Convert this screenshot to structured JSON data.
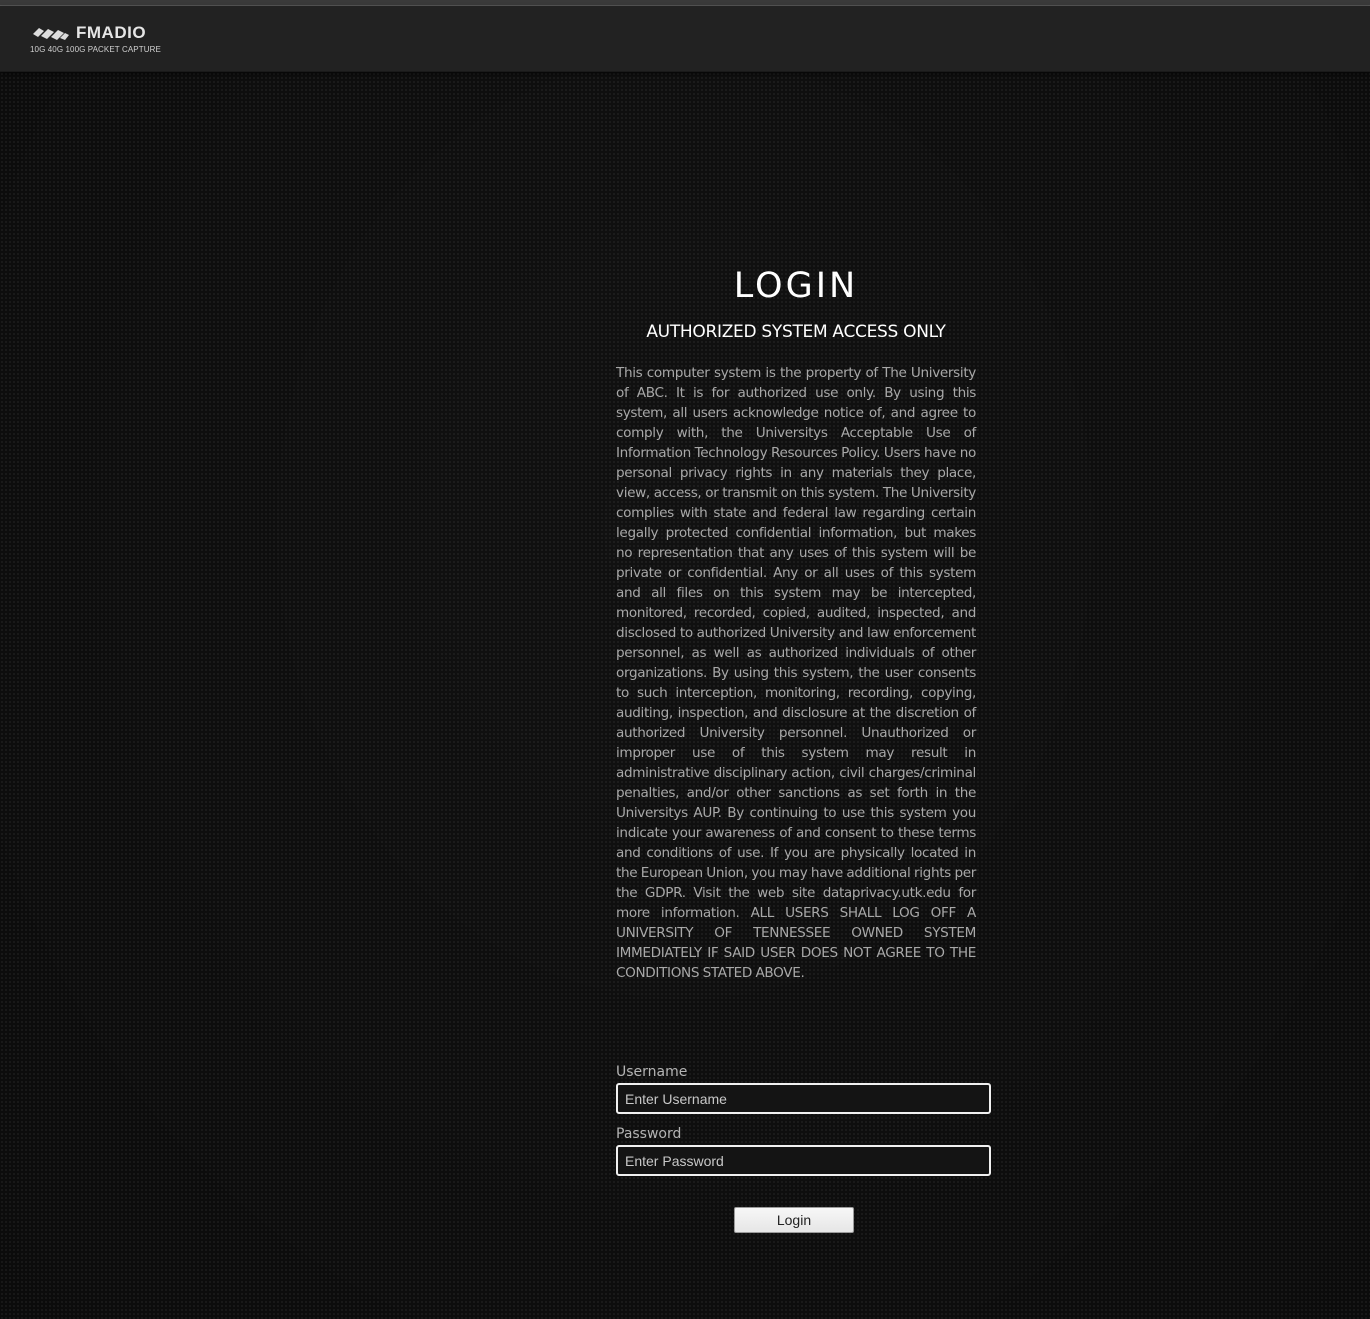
{
  "header": {
    "brand_name": "FMADIO",
    "brand_tagline": "10G 40G 100G  PACKET CAPTURE",
    "logo_icon": "fmadio-logo-icon"
  },
  "login": {
    "title": "LOGIN",
    "subtitle": "AUTHORIZED SYSTEM ACCESS ONLY",
    "disclaimer": "This computer system is the property of The University of ABC. It is for authorized use only. By using this system, all users acknowledge notice of, and agree to comply with, the Universitys Acceptable Use of Information Technology Resources Policy. Users have no personal privacy rights in any materials they place, view, access, or transmit on this system. The University complies with state and federal law regarding certain legally protected confidential information, but makes no representation that any uses of this system will be private or confidential. Any or all uses of this system and all files on this system may be intercepted, monitored, recorded, copied, audited, inspected, and disclosed to authorized University and law enforcement personnel, as well as authorized individuals of other organizations. By using this system, the user consents to such interception, monitoring, recording, copying, auditing, inspection, and disclosure at the discretion of authorized University personnel. Unauthorized or improper use of this system may result in administrative disciplinary action, civil charges/criminal penalties, and/or other sanctions as set forth in the Universitys AUP. By continuing to use this system you indicate your awareness of and consent to these terms and conditions of use. If you are physically located in the European Union, you may have additional rights per the GDPR. Visit the web site dataprivacy.utk.edu for more information. ALL USERS SHALL LOG OFF A UNIVERSITY OF TENNESSEE OWNED SYSTEM IMMEDIATELY IF SAID USER DOES NOT AGREE TO THE CONDITIONS STATED ABOVE.",
    "username_label": "Username",
    "username_placeholder": "Enter Username",
    "username_value": "",
    "password_label": "Password",
    "password_placeholder": "Enter Password",
    "password_value": "",
    "button_label": "Login"
  },
  "colors": {
    "background": "#111111",
    "navbar": "#222222",
    "title_text": "#ffffff",
    "body_text": "#a8a8a8",
    "input_border": "#f0f0f0"
  }
}
